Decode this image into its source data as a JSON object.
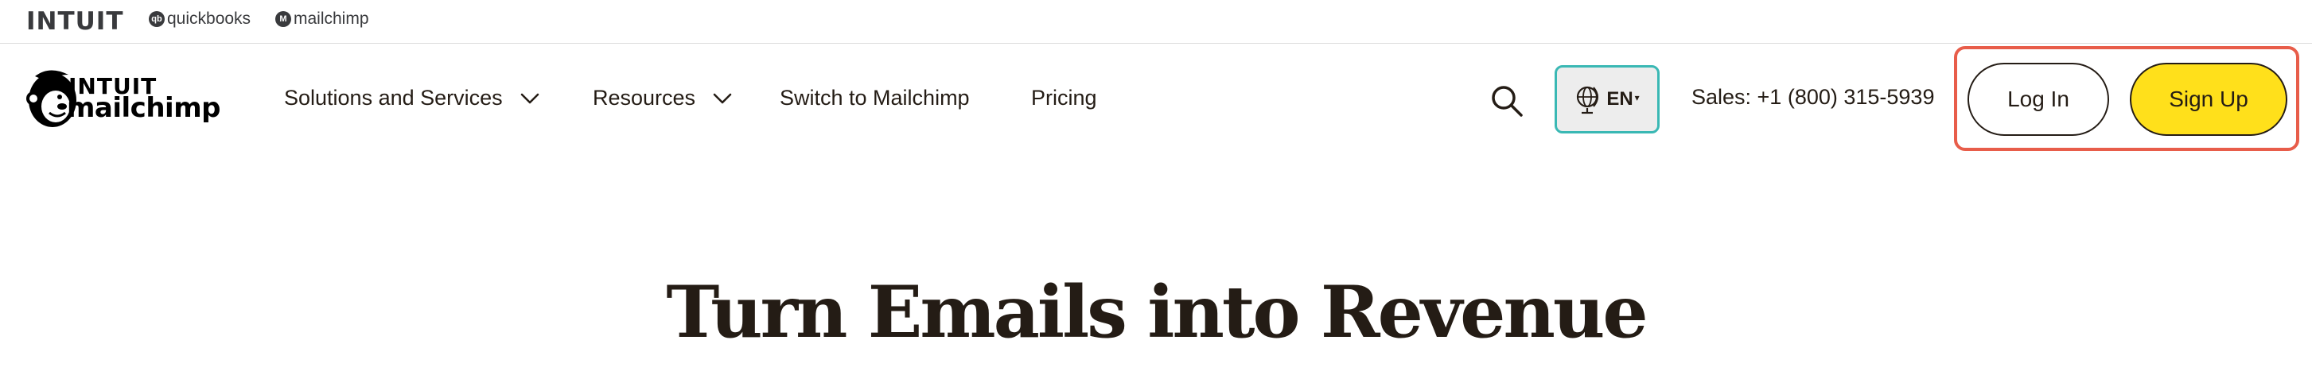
{
  "topbar": {
    "intuit": "INTUIT",
    "quickbooks_badge": "qb",
    "quickbooks": "quickbooks",
    "mailchimp_badge": "M",
    "mailchimp": "mailchimp"
  },
  "logo": {
    "line1": "INTUIT",
    "line2": "mailchimp"
  },
  "nav": {
    "solutions": "Solutions and Services",
    "resources": "Resources",
    "switch": "Switch to Mailchimp",
    "pricing": "Pricing"
  },
  "icons": {
    "search": "search-icon",
    "globe": "globe-icon",
    "chevron": "chevron-down-icon"
  },
  "language": {
    "label": "EN",
    "caret": "▾"
  },
  "sales": "Sales: +1 (800) 315-5939",
  "auth": {
    "login": "Log In",
    "signup": "Sign Up"
  },
  "hero": {
    "title": "Turn Emails into Revenue"
  },
  "colors": {
    "accent_yellow": "#ffe01b",
    "highlight_red": "#e85d4a",
    "lang_border": "#3ab8b4",
    "text": "#241c15"
  }
}
